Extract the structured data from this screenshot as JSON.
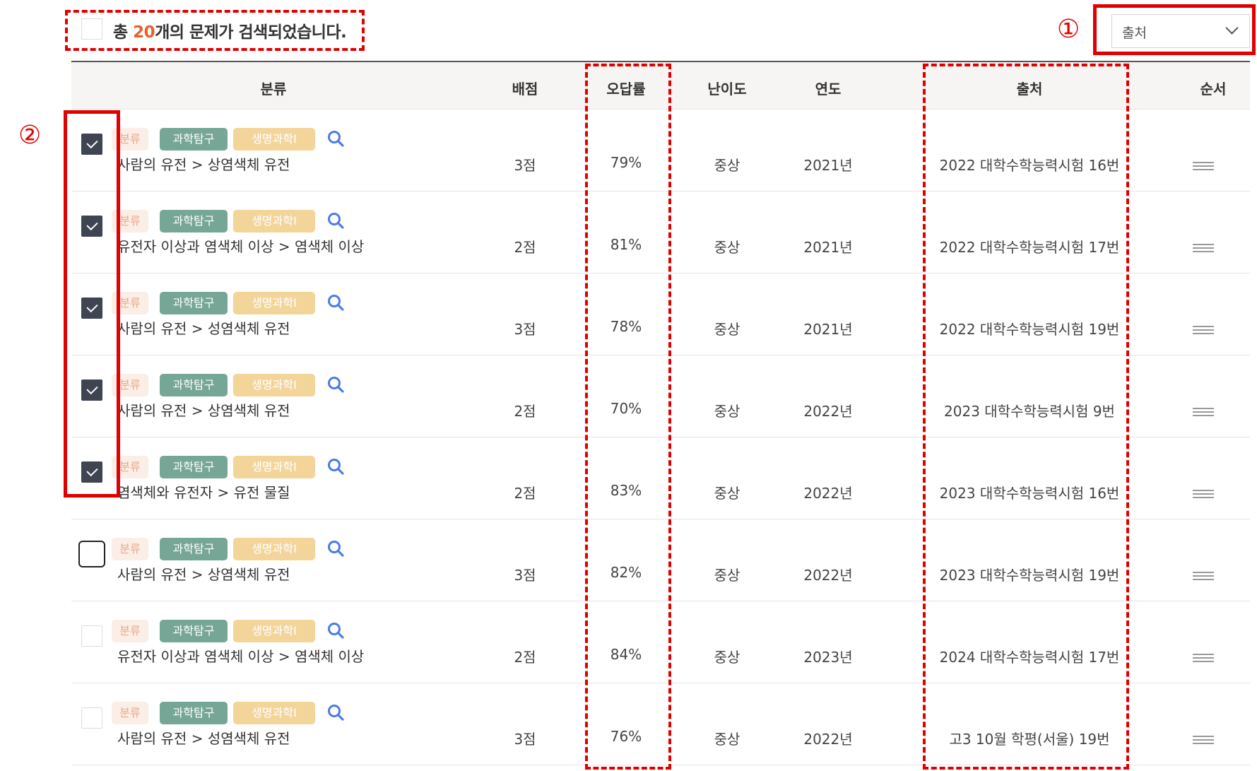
{
  "summary": {
    "prefix": "총 ",
    "count": "20",
    "suffix": "개의 문제가 검색되었습니다."
  },
  "annotations": {
    "marker1": "①",
    "marker2": "②"
  },
  "sort": {
    "selected": "출처"
  },
  "columns": {
    "category": "분류",
    "points": "배점",
    "error_rate": "오답률",
    "difficulty": "난이도",
    "year": "연도",
    "source": "출처",
    "order": "순서"
  },
  "rows": [
    {
      "checked": true,
      "tag1": "분류",
      "tag2": "과학탐구",
      "tag3": "생명과학Ⅰ",
      "category": "사람의 유전 > 상염색체 유전",
      "points": "3점",
      "error_rate": "79%",
      "difficulty": "중상",
      "year": "2021년",
      "source": "2022 대학수학능력시험 16번"
    },
    {
      "checked": true,
      "tag1": "분류",
      "tag2": "과학탐구",
      "tag3": "생명과학Ⅰ",
      "category": "유전자 이상과 염색체 이상 > 염색체 이상",
      "points": "2점",
      "error_rate": "81%",
      "difficulty": "중상",
      "year": "2021년",
      "source": "2022 대학수학능력시험 17번"
    },
    {
      "checked": true,
      "tag1": "분류",
      "tag2": "과학탐구",
      "tag3": "생명과학Ⅰ",
      "category": "사람의 유전 > 성염색체 유전",
      "points": "3점",
      "error_rate": "78%",
      "difficulty": "중상",
      "year": "2021년",
      "source": "2022 대학수학능력시험 19번"
    },
    {
      "checked": true,
      "tag1": "분류",
      "tag2": "과학탐구",
      "tag3": "생명과학Ⅰ",
      "category": "사람의 유전 > 상염색체 유전",
      "points": "2점",
      "error_rate": "70%",
      "difficulty": "중상",
      "year": "2022년",
      "source": "2023 대학수학능력시험 9번"
    },
    {
      "checked": true,
      "tag1": "분류",
      "tag2": "과학탐구",
      "tag3": "생명과학Ⅰ",
      "category": "염색체와 유전자 > 유전 물질",
      "points": "2점",
      "error_rate": "83%",
      "difficulty": "중상",
      "year": "2022년",
      "source": "2023 대학수학능력시험 16번"
    },
    {
      "checked": false,
      "focused": true,
      "tag1": "분류",
      "tag2": "과학탐구",
      "tag3": "생명과학Ⅰ",
      "category": "사람의 유전 > 상염색체 유전",
      "points": "3점",
      "error_rate": "82%",
      "difficulty": "중상",
      "year": "2022년",
      "source": "2023 대학수학능력시험 19번"
    },
    {
      "checked": false,
      "tag1": "분류",
      "tag2": "과학탐구",
      "tag3": "생명과학Ⅰ",
      "category": "유전자 이상과 염색체 이상 > 염색체 이상",
      "points": "2점",
      "error_rate": "84%",
      "difficulty": "중상",
      "year": "2023년",
      "source": "2024 대학수학능력시험 17번"
    },
    {
      "checked": false,
      "tag1": "분류",
      "tag2": "과학탐구",
      "tag3": "생명과학Ⅰ",
      "category": "사람의 유전 > 성염색체 유전",
      "points": "3점",
      "error_rate": "76%",
      "difficulty": "중상",
      "year": "2022년",
      "source": "고3 10월 학평(서울) 19번"
    }
  ],
  "colors": {
    "highlight": "#e00000",
    "count_accent": "#e8602c",
    "tag_category_bg": "#fbeee6",
    "tag_subject_bg": "#76a796",
    "tag_course_bg": "#f3d59a",
    "checkbox_checked": "#3f4452",
    "search_icon": "#4a7be8"
  },
  "icons": {
    "row_search": "search-icon",
    "row_order": "drag-handle-icon",
    "sort_dropdown": "chevron-down-icon"
  }
}
